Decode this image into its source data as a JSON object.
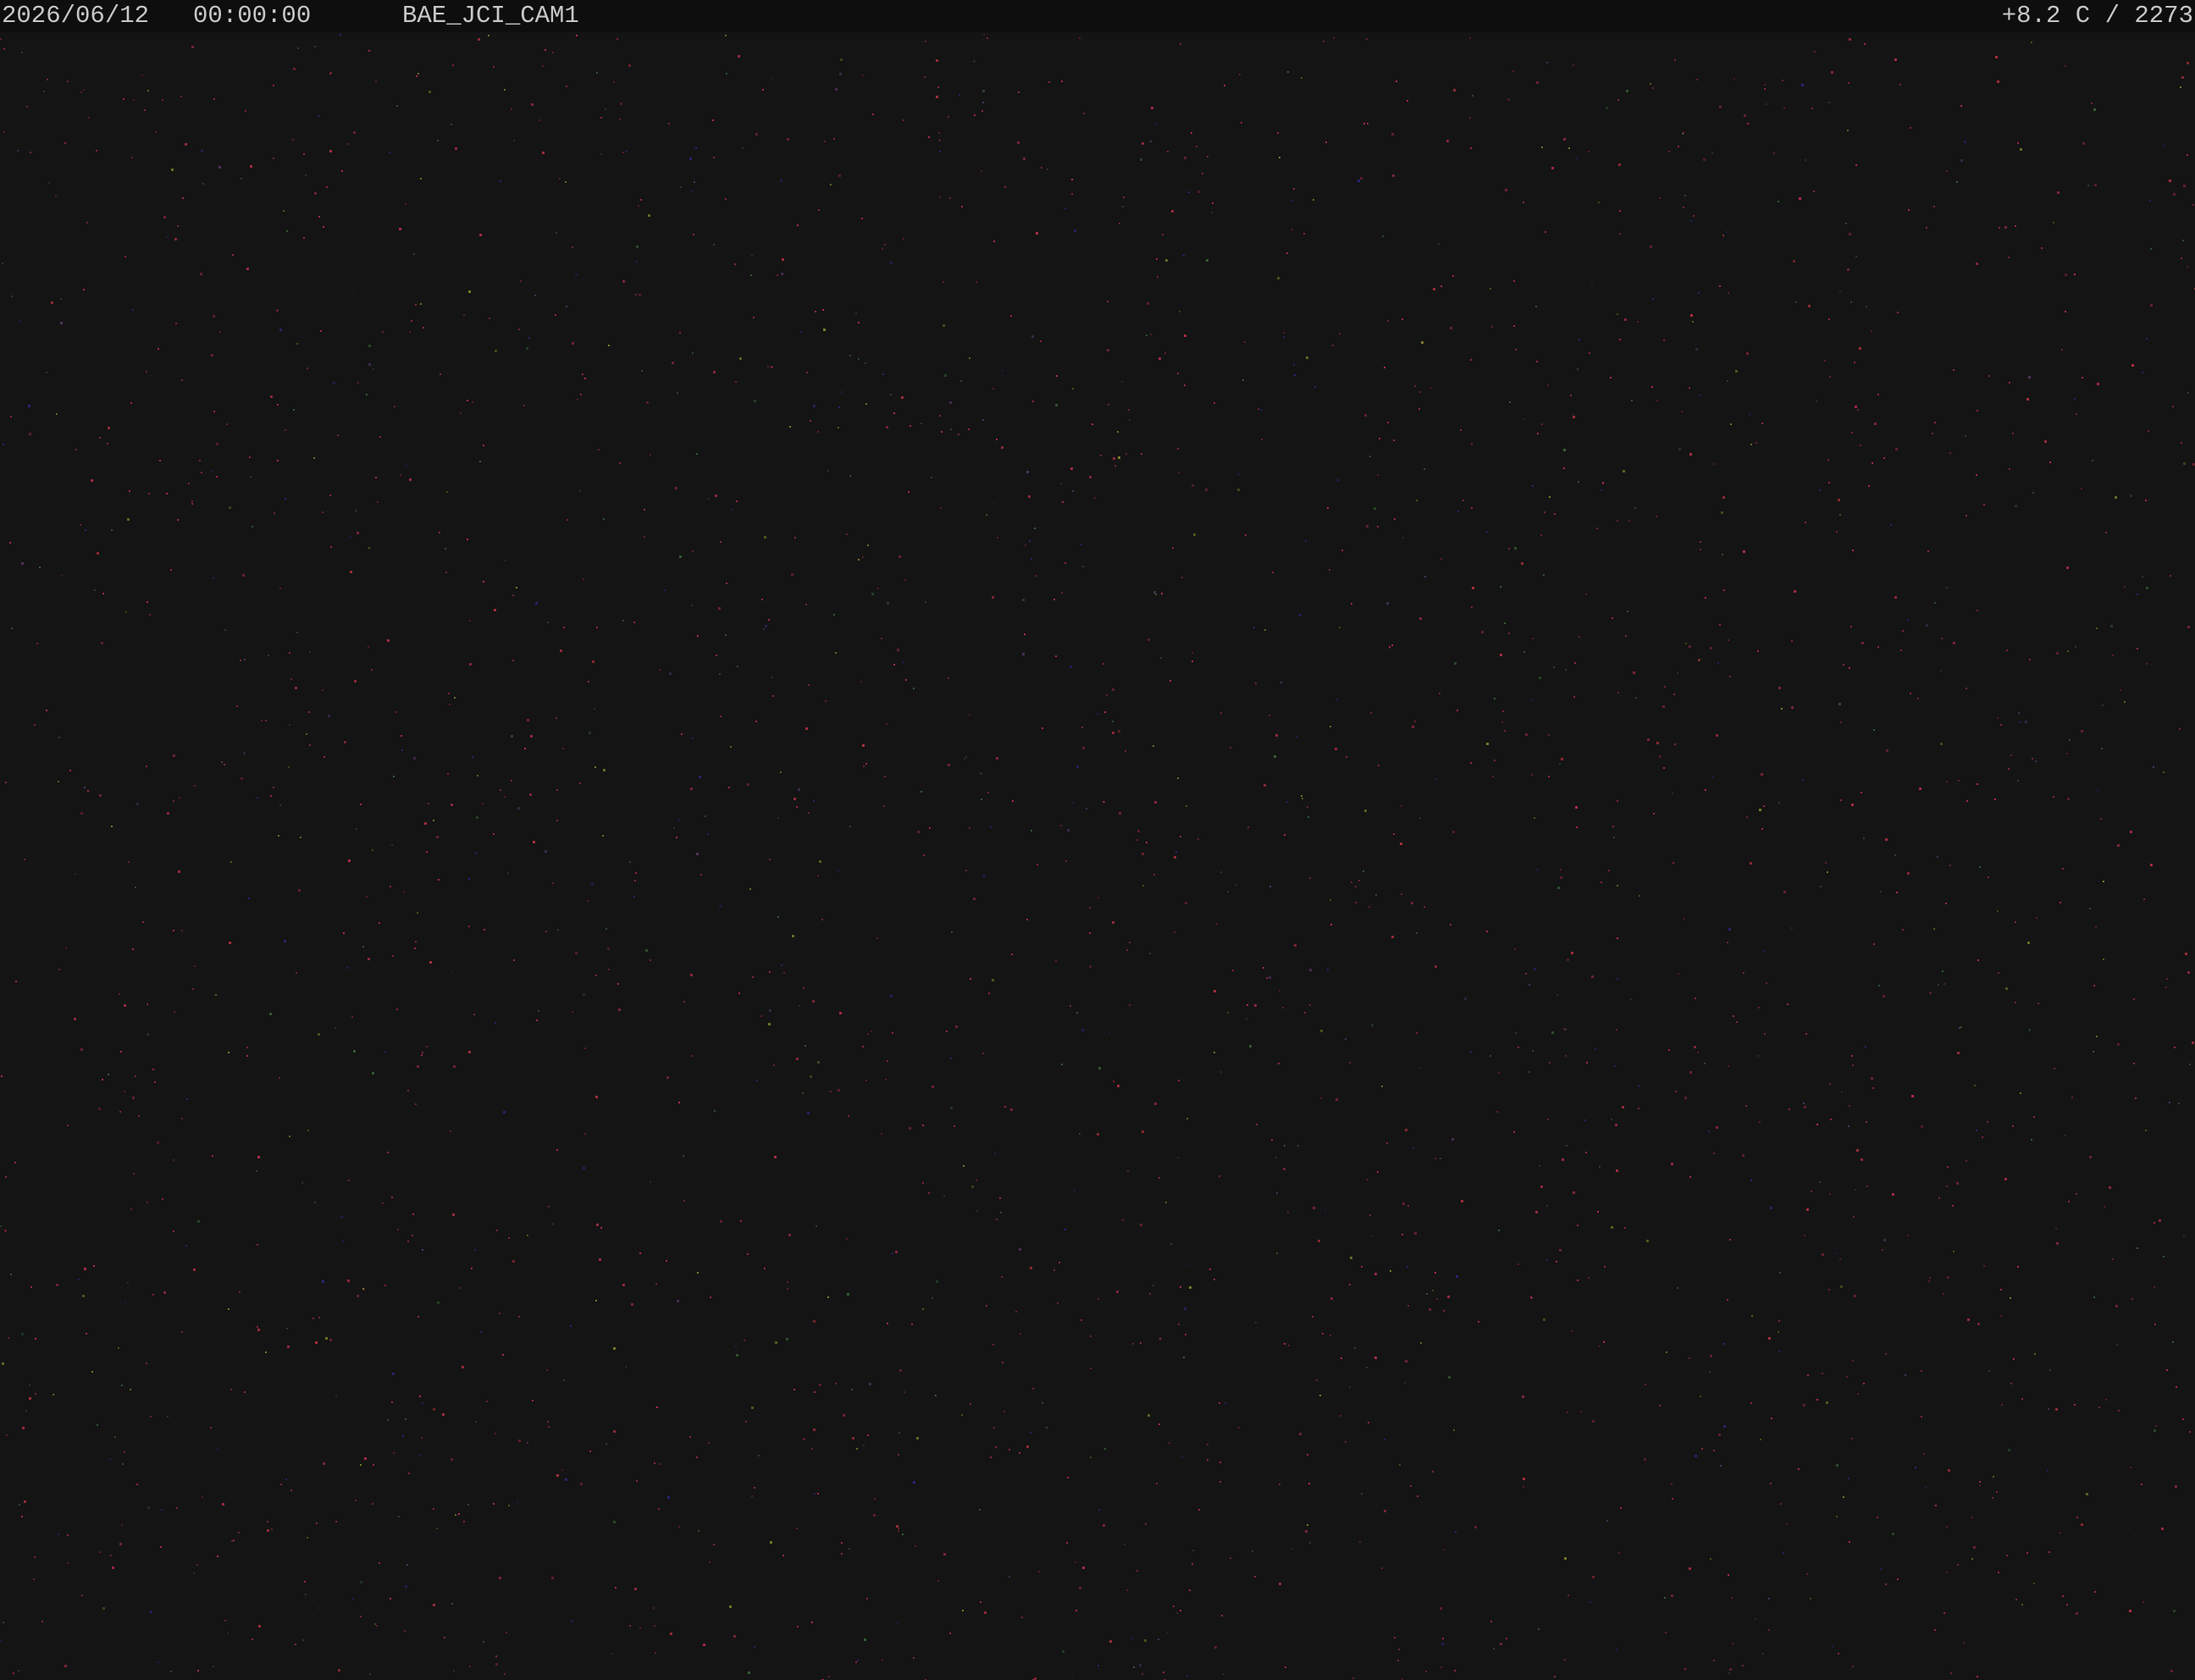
{
  "overlay": {
    "date": "2026/06/12",
    "time": "00:00:00",
    "camera_name": "BAE_JCI_CAM1",
    "temperature_reading": "+8.2 C / 2273"
  },
  "colors": {
    "background": "#141414",
    "overlay_bar": "#0e0e0e",
    "overlay_text": "#c8c8c8",
    "noise": [
      "#c0304a",
      "#a02a3a",
      "#3a6a3a",
      "#2a2a8a",
      "#8a8a2a",
      "#5a3a6a"
    ]
  }
}
